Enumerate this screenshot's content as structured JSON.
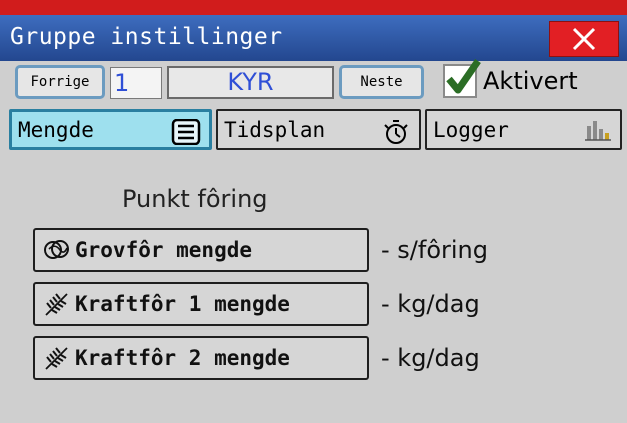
{
  "window": {
    "title": "Gruppe instillinger",
    "close_icon": "close-icon"
  },
  "nav": {
    "prev_label": "Forrige",
    "number_value": "1",
    "name_value": "KYR",
    "next_label": "Neste",
    "active_checked": true,
    "active_label": "Aktivert"
  },
  "tabs": [
    {
      "label": "Mengde",
      "icon": "list-icon",
      "active": true
    },
    {
      "label": "Tidsplan",
      "icon": "timer-icon",
      "active": false
    },
    {
      "label": "Logger",
      "icon": "bar-chart-icon",
      "active": false
    }
  ],
  "section": {
    "heading": "Punkt fôring"
  },
  "rows": [
    {
      "button": "Grovfôr mengde",
      "icon": "roughage-icon",
      "unit": "- s/fôring"
    },
    {
      "button": "Kraftfôr 1 mengde",
      "icon": "wheat-icon",
      "unit": "- kg/dag"
    },
    {
      "button": "Kraftfôr 2 mengde",
      "icon": "wheat-icon",
      "unit": "- kg/dag"
    }
  ],
  "colors": {
    "titlebar": "#2f5aa8",
    "close": "#e21f24",
    "active_tab": "#9ee0ee",
    "field_text": "#2f4fd6",
    "background": "#cfcfcf"
  }
}
